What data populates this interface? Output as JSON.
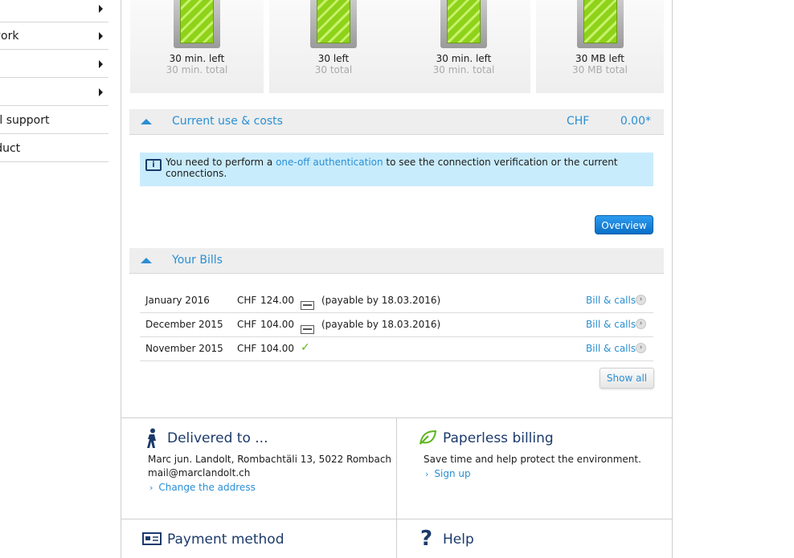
{
  "sidenav": {
    "items": [
      {
        "label": ""
      },
      {
        "label": "Network"
      },
      {
        "label": ""
      },
      {
        "label": ""
      },
      {
        "label": "Technical support"
      },
      {
        "label": "Product"
      }
    ]
  },
  "tiles": [
    {
      "left": "30 min. left",
      "total": "30 min. total"
    },
    {
      "left": "30 left",
      "total": "30 total"
    },
    {
      "left": "30 min. left",
      "total": "30 min. total"
    },
    {
      "left": "30 MB left",
      "total": "30 MB total"
    }
  ],
  "current_use": {
    "title": "Current use & costs",
    "currency": "CHF",
    "amount": "0.00*"
  },
  "info": {
    "prefix": "You need to perform a ",
    "link": "one-off authentication",
    "suffix": " to see the connection verification or the current connections."
  },
  "overview_button": "Overview",
  "bills": {
    "title": "Your Bills",
    "rows": [
      {
        "month": "January 2016",
        "currency": "CHF",
        "amount": "124.00",
        "status": "card-icon",
        "payable": "(payable by 18.03.2016)",
        "link": "Bill & calls"
      },
      {
        "month": "December 2015",
        "currency": "CHF",
        "amount": "104.00",
        "status": "card-icon",
        "payable": "(payable by 18.03.2016)",
        "link": "Bill & calls"
      },
      {
        "month": "November 2015",
        "currency": "CHF",
        "amount": "104.00",
        "status": "check-icon",
        "payable": "",
        "link": "Bill & calls"
      }
    ],
    "show_all": "Show all"
  },
  "delivered": {
    "title": "Delivered to ...",
    "address": "Marc jun. Landolt, Rombachtäli 13, 5022 Rombach",
    "email": "mail@marclandolt.ch",
    "link": "Change the address"
  },
  "paperless": {
    "title": "Paperless billing",
    "text": "Save time and help protect the environment.",
    "link": "Sign up"
  },
  "payment": {
    "title": "Payment method"
  },
  "help": {
    "title": "Help"
  },
  "colors": {
    "accent": "#2a8fd4",
    "dark_blue": "#1b3a6b",
    "info_bg": "#c9ecfc",
    "battery_green": "#8ed21a"
  }
}
